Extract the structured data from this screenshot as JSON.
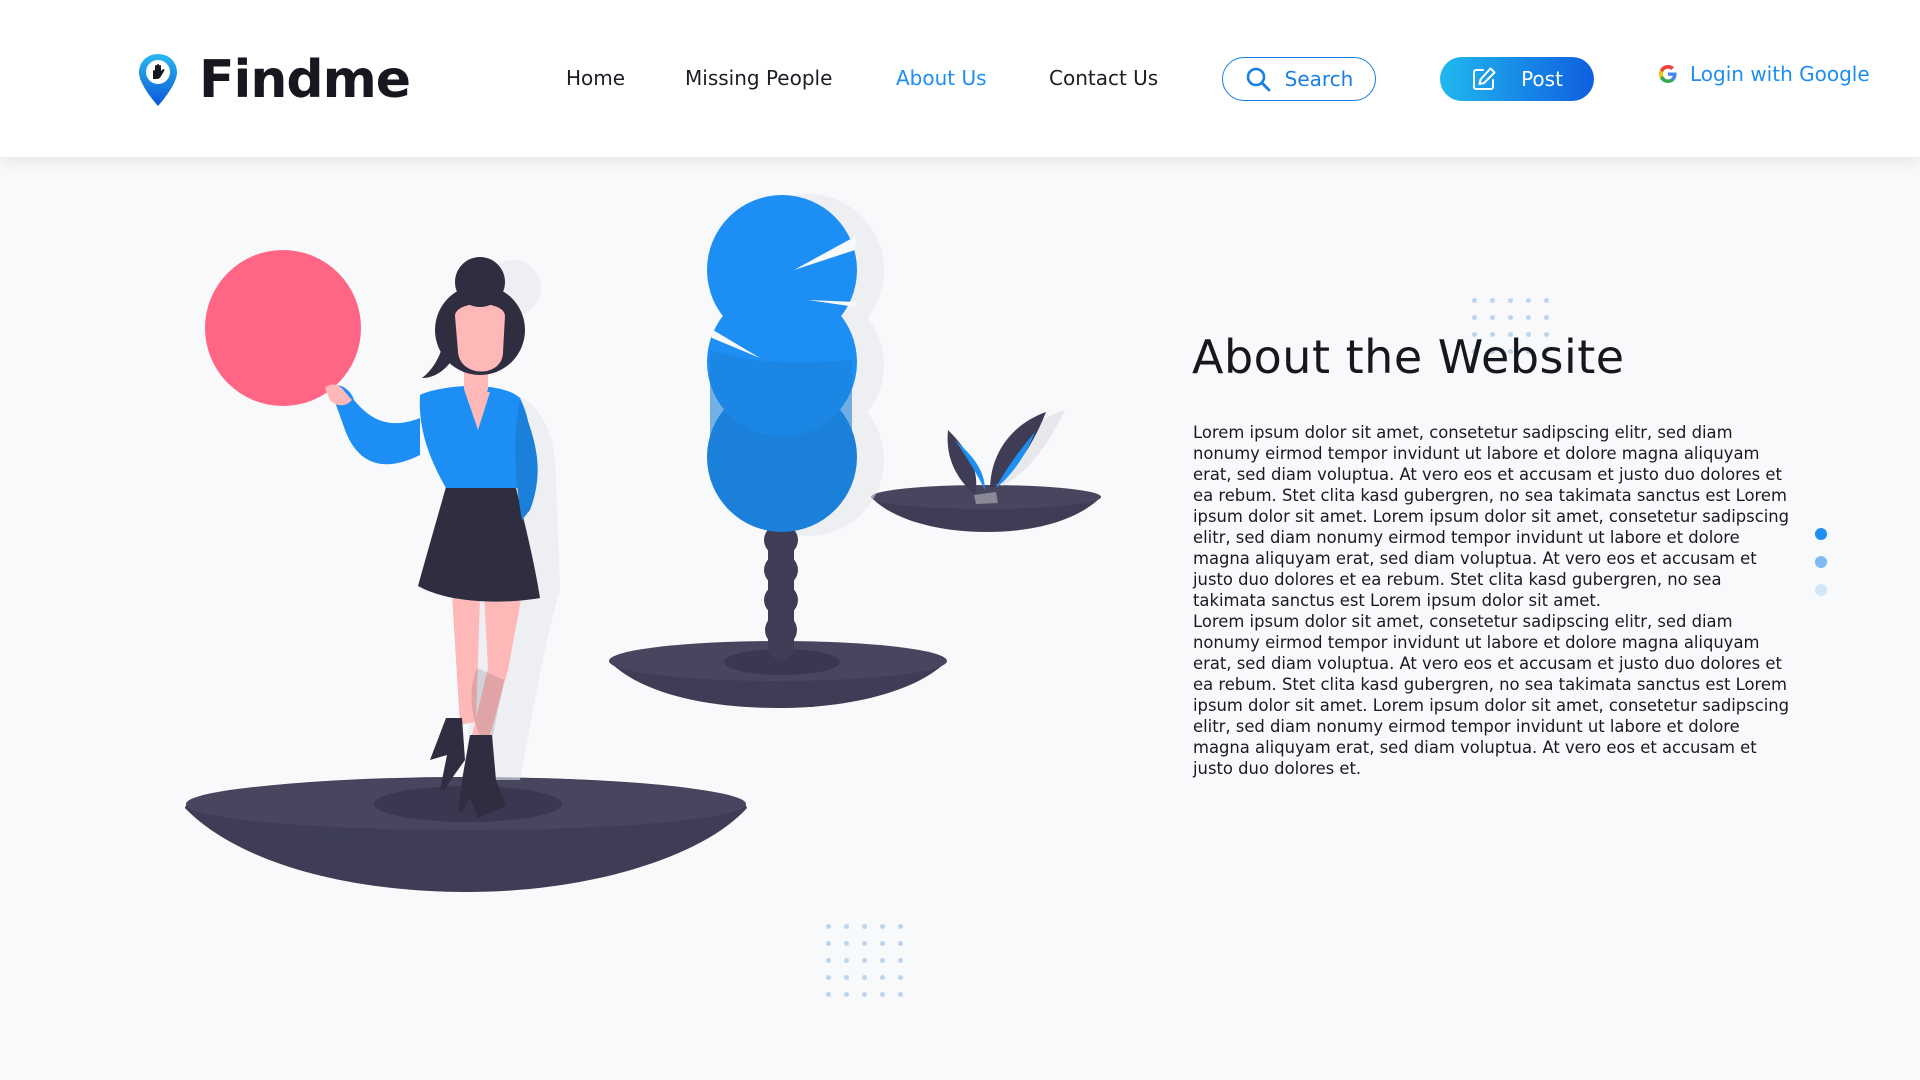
{
  "brand": {
    "name": "Findme"
  },
  "nav": {
    "items": [
      {
        "label": "Home"
      },
      {
        "label": "Missing People"
      },
      {
        "label": "About Us",
        "active": true
      },
      {
        "label": "Contact Us"
      }
    ],
    "search_label": "Search",
    "post_label": "Post",
    "login_label": "Login with Google"
  },
  "about": {
    "title": "About the Website",
    "paragraphs": [
      "Lorem ipsum dolor sit amet, consetetur sadipscing elitr, sed diam nonumy eirmod tempor invidunt ut labore et dolore magna aliquyam erat, sed diam voluptua. At vero eos et accusam et justo duo dolores et ea rebum. Stet clita kasd gubergren, no sea takimata sanctus est Lorem ipsum dolor sit amet. Lorem ipsum dolor sit amet, consetetur sadipscing elitr, sed diam nonumy eirmod tempor invidunt ut labore et dolore magna aliquyam erat, sed diam voluptua. At vero eos et accusam et justo duo dolores et ea rebum. Stet clita kasd gubergren, no sea takimata sanctus est Lorem ipsum dolor sit amet.",
      "Lorem ipsum dolor sit amet, consetetur sadipscing elitr, sed diam nonumy eirmod tempor invidunt ut labore et dolore magna aliquyam erat, sed diam voluptua. At vero eos et accusam et justo duo dolores et ea rebum. Stet clita kasd gubergren, no sea takimata sanctus est Lorem ipsum dolor sit amet. Lorem ipsum dolor sit amet, consetetur sadipscing elitr, sed diam nonumy eirmod tempor invidunt ut labore et dolore magna aliquyam erat, sed diam voluptua. At vero eos et accusam et justo duo dolores et."
    ]
  },
  "pager": {
    "count": 3,
    "active_index": 0
  },
  "colors": {
    "accent": "#1d8ef3",
    "accent_dark": "#0f5fe0",
    "ball": "#ff6584",
    "platform": "#3f3d56",
    "hair": "#2f2e41",
    "skin": "#ffb8b8"
  },
  "icons": {
    "logo": "location-pin-hand-icon",
    "search": "magnifier-icon",
    "post": "edit-square-icon",
    "google": "google-g-icon"
  }
}
